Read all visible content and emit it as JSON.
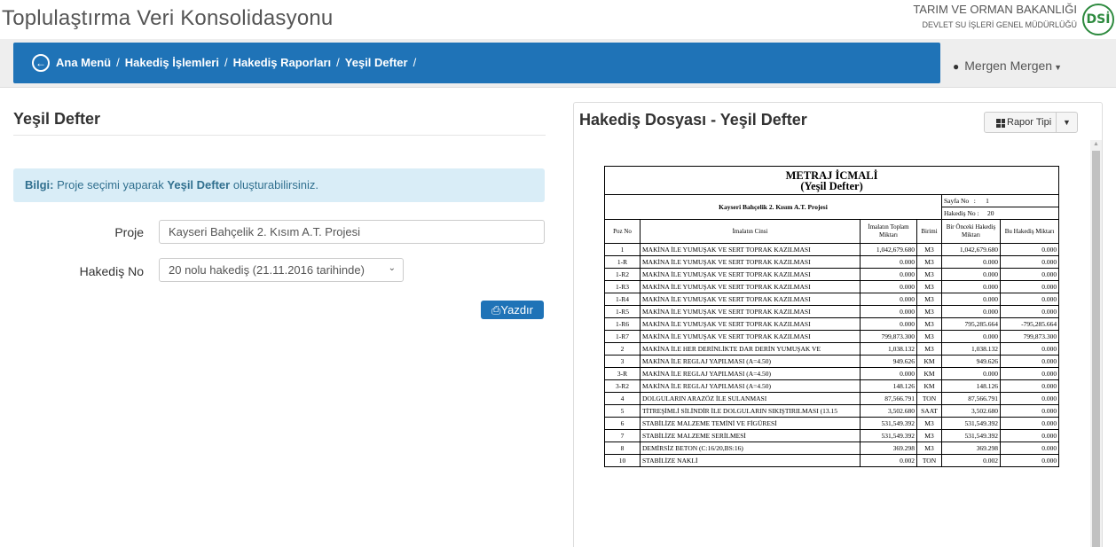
{
  "app": {
    "title": "Toplulaştırma Veri Konsolidasyonu",
    "org_line1": "TARIM VE ORMAN BAKANLIĞI",
    "org_line2": "DEVLET SU İŞLERİ GENEL MÜDÜRLÜĞÜ",
    "logo_text": "DSİ"
  },
  "nav": {
    "breadcrumb": [
      "Ana Menü",
      "Hakediş İşlemleri",
      "Hakediş Raporları",
      "Yeşil Defter"
    ],
    "separator": "/",
    "user_name": "Mergen Mergen"
  },
  "left": {
    "title": "Yeşil Defter",
    "info_prefix": "Bilgi:",
    "info_text_1": "Proje seçimi yaparak",
    "info_bold": "Yeşil Defter",
    "info_text_2": "oluşturabilirsiniz.",
    "proje_label": "Proje",
    "proje_value": "Kayseri Bahçelik 2. Kısım A.T. Projesi",
    "hakedis_label": "Hakediş No",
    "hakedis_value": "20 nolu hakediş (21.11.2016 tarihinde)",
    "print_label": "Yazdır"
  },
  "right": {
    "title": "Hakediş Dosyası - Yeşil Defter",
    "rapor_tipi_label": "Rapor Tipi"
  },
  "report": {
    "title1": "METRAJ İCMALİ",
    "title2": "(Yeşil Defter)",
    "project": "Kayseri Bahçelik 2. Kısım A.T. Projesi",
    "sayfa_label": "Sayfa No",
    "sayfa_value": "1",
    "hakedis_label": "Hakediş No",
    "hakedis_value": "20",
    "meta_sep": ":",
    "columns": [
      "Poz No",
      "İmalatın Cinsi",
      "İmalatın Toplam Miktarı",
      "Birimi",
      "Bir Önceki Hakediş Miktarı",
      "Bu Hakediş Miktarı"
    ],
    "rows": [
      [
        "1",
        "MAKİNA İLE YUMUŞAK VE SERT TOPRAK KAZILMASI",
        "1,042,679.680",
        "M3",
        "1,042,679.680",
        "0.000"
      ],
      [
        "1-R",
        "MAKİNA İLE YUMUŞAK VE SERT TOPRAK KAZILMASI",
        "0.000",
        "M3",
        "0.000",
        "0.000"
      ],
      [
        "1-R2",
        "MAKİNA İLE YUMUŞAK VE SERT TOPRAK KAZILMASI",
        "0.000",
        "M3",
        "0.000",
        "0.000"
      ],
      [
        "1-R3",
        "MAKİNA İLE YUMUŞAK VE SERT TOPRAK KAZILMASI",
        "0.000",
        "M3",
        "0.000",
        "0.000"
      ],
      [
        "1-R4",
        "MAKİNA İLE YUMUŞAK VE SERT TOPRAK KAZILMASI",
        "0.000",
        "M3",
        "0.000",
        "0.000"
      ],
      [
        "1-R5",
        "MAKİNA İLE YUMUŞAK VE SERT TOPRAK KAZILMASI",
        "0.000",
        "M3",
        "0.000",
        "0.000"
      ],
      [
        "1-R6",
        "MAKİNA İLE YUMUŞAK VE SERT TOPRAK KAZILMASI",
        "0.000",
        "M3",
        "795,285.664",
        "-795,285.664"
      ],
      [
        "1-R7",
        "MAKİNA İLE YUMUŞAK VE SERT TOPRAK KAZILMASI",
        "799,873.300",
        "M3",
        "0.000",
        "799,873.300"
      ],
      [
        "2",
        "MAKİNA İLE HER DERİNLİKTE DAR DERİN YUMUŞAK VE",
        "1,038.132",
        "M3",
        "1,038.132",
        "0.000"
      ],
      [
        "3",
        "MAKİNA İLE REGLAJ YAPILMASI (A=4.50)",
        "949.626",
        "KM",
        "949.626",
        "0.000"
      ],
      [
        "3-R",
        "MAKİNA İLE REGLAJ YAPILMASI (A=4.50)",
        "0.000",
        "KM",
        "0.000",
        "0.000"
      ],
      [
        "3-R2",
        "MAKİNA İLE REGLAJ YAPILMASI (A=4.50)",
        "148.126",
        "KM",
        "148.126",
        "0.000"
      ],
      [
        "4",
        "DOLGULARIN ARAZÖZ İLE SULANMASI",
        "87,566.791",
        "TON",
        "87,566.791",
        "0.000"
      ],
      [
        "5",
        "TİTREŞİMLİ SİLİNDİR İLE DOLGULARIN SIKIŞTIRILMASI (13.15",
        "3,502.680",
        "SAAT",
        "3,502.680",
        "0.000"
      ],
      [
        "6",
        "STABİLİZE MALZEME TEMİNİ VE FİGÜRESİ",
        "531,549.392",
        "M3",
        "531,549.392",
        "0.000"
      ],
      [
        "7",
        "STABİLİZE MALZEME SERİLMESİ",
        "531,549.392",
        "M3",
        "531,549.392",
        "0.000"
      ],
      [
        "8",
        "DEMİRSİZ BETON (C:16/20,BS:16)",
        "369.298",
        "M3",
        "369.298",
        "0.000"
      ],
      [
        "10",
        "STABİLİZE NAKLİ",
        "0.002",
        "TON",
        "0.002",
        "0.000"
      ]
    ]
  }
}
